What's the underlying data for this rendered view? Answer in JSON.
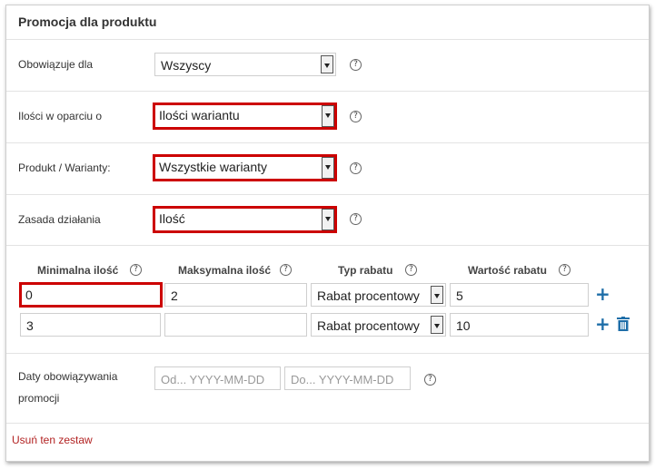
{
  "panel": {
    "title": "Promocja dla produktu"
  },
  "fields": {
    "applies_to": {
      "label": "Obowiązuje dla",
      "value": "Wszyscy"
    },
    "quantity_basis": {
      "label": "Ilości w oparciu o",
      "value": "Ilości wariantu"
    },
    "product_variants": {
      "label": "Produkt / Warianty:",
      "value": "Wszystkie warianty"
    },
    "rule": {
      "label": "Zasada działania",
      "value": "Ilość"
    }
  },
  "help_glyph": "?",
  "table": {
    "headers": {
      "min": "Minimalna ilość",
      "max": "Maksymalna ilość",
      "type": "Typ rabatu",
      "value": "Wartość rabatu"
    },
    "rows": [
      {
        "min": "0",
        "max": "2",
        "type": "Rabat procentowy",
        "value": "5"
      },
      {
        "min": "3",
        "max": "",
        "type": "Rabat procentowy",
        "value": "10"
      }
    ],
    "add_glyph": "+"
  },
  "dates": {
    "label_line1": "Daty obowiązywania",
    "label_line2": "promocji",
    "from_placeholder": "Od... YYYY-MM-DD",
    "to_placeholder": "Do... YYYY-MM-DD"
  },
  "remove_link": "Usuń ten zestaw",
  "colors": {
    "highlight": "#cc0000",
    "accent": "#1e6ea8",
    "link": "#b22222"
  }
}
